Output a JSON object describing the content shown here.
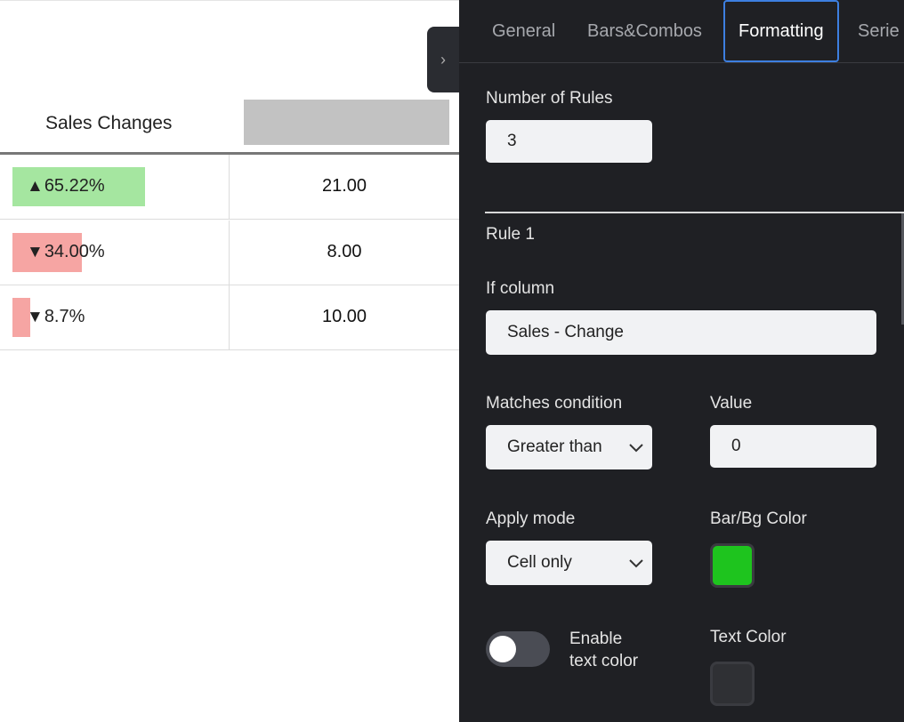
{
  "table": {
    "column_header": "Sales Changes",
    "rows": [
      {
        "arrow": "▲",
        "change": "65.22%",
        "value": "21.00",
        "bar_color": "#a5e6a0",
        "bar_fraction": 1.0
      },
      {
        "arrow": "▼",
        "change": "34.00%",
        "value": "8.00",
        "bar_color": "#f6a5a3",
        "bar_fraction": 0.52
      },
      {
        "arrow": "▼",
        "change": "8.7%",
        "value": "10.00",
        "bar_color": "#f6a5a3",
        "bar_fraction": 0.13
      }
    ]
  },
  "collapse_icon": "chevron-right-icon",
  "tabs": [
    {
      "label": "General",
      "active": false
    },
    {
      "label": "Bars&Combos",
      "active": false
    },
    {
      "label": "Formatting",
      "active": true
    },
    {
      "label": "Serie",
      "active": false
    }
  ],
  "formatting": {
    "number_of_rules_label": "Number of Rules",
    "number_of_rules_value": "3",
    "rule_title": "Rule 1",
    "if_column_label": "If column",
    "if_column_value": "Sales - Change",
    "matches_condition_label": "Matches condition",
    "matches_condition_value": "Greater than",
    "value_label": "Value",
    "value_value": "0",
    "apply_mode_label": "Apply mode",
    "apply_mode_value": "Cell only",
    "bar_bg_color_label": "Bar/Bg Color",
    "bar_bg_color": "#1ec41e",
    "enable_text_color_label_line1": "Enable",
    "enable_text_color_label_line2": "text color",
    "enable_text_color_on": false,
    "text_color_label": "Text Color",
    "text_color": "#2f3034"
  }
}
